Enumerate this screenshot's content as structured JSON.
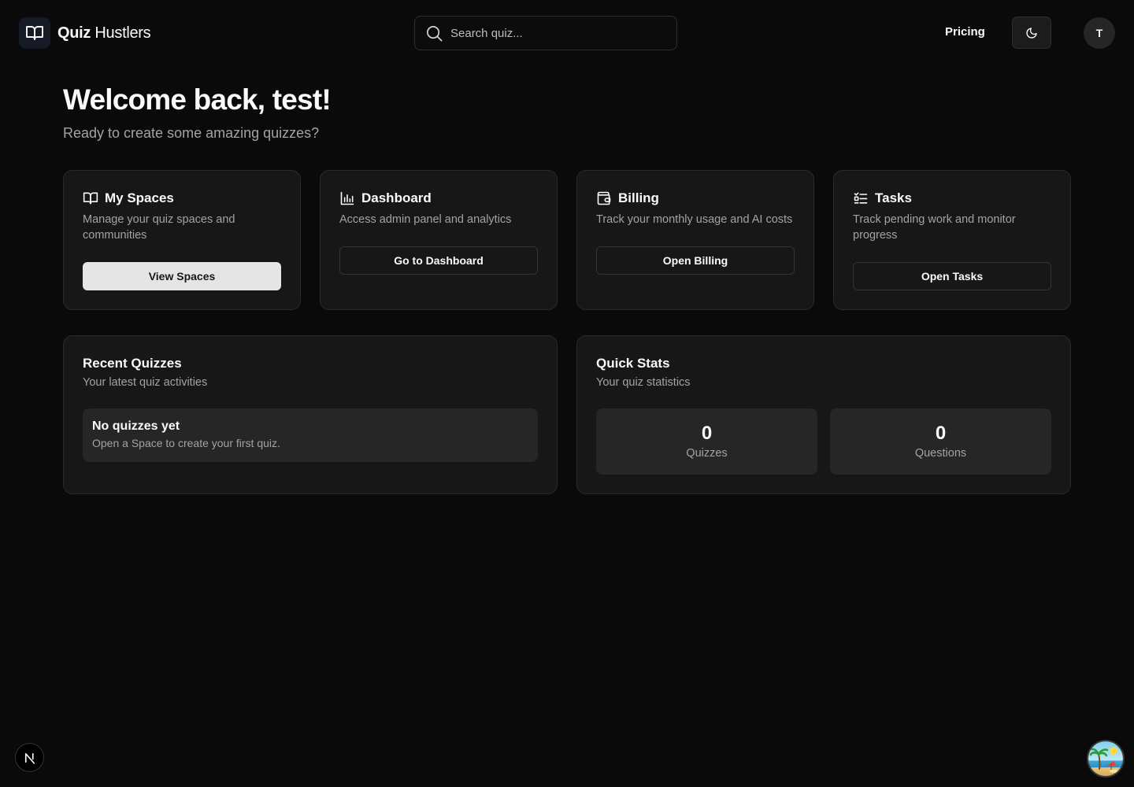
{
  "header": {
    "brand_strong": "Quiz",
    "brand_light": " Hustlers",
    "search_placeholder": "Search quiz...",
    "pricing_label": "Pricing",
    "avatar_initial": "T"
  },
  "welcome": {
    "title": "Welcome back, test!",
    "subtitle": "Ready to create some amazing quizzes?"
  },
  "cards": [
    {
      "title": "My Spaces",
      "description": "Manage your quiz spaces and communities",
      "button": "View Spaces",
      "icon": "book-open-icon"
    },
    {
      "title": "Dashboard",
      "description": "Access admin panel and analytics",
      "button": "Go to Dashboard",
      "icon": "bar-chart-icon"
    },
    {
      "title": "Billing",
      "description": "Track your monthly usage and AI costs",
      "button": "Open Billing",
      "icon": "wallet-icon"
    },
    {
      "title": "Tasks",
      "description": "Track pending work and monitor progress",
      "button": "Open Tasks",
      "icon": "list-checks-icon"
    }
  ],
  "recent": {
    "title": "Recent Quizzes",
    "subtitle": "Your latest quiz activities",
    "empty_title": "No quizzes yet",
    "empty_desc": "Open a Space to create your first quiz."
  },
  "stats": {
    "title": "Quick Stats",
    "subtitle": "Your quiz statistics",
    "items": [
      {
        "value": "0",
        "label": "Quizzes"
      },
      {
        "value": "0",
        "label": "Questions"
      }
    ]
  },
  "colors": {
    "background": "#0a0a0a",
    "card": "#171717",
    "border": "#2a2a2a",
    "muted_text": "#a3a3a3",
    "primary_button": "#e5e5e5"
  }
}
